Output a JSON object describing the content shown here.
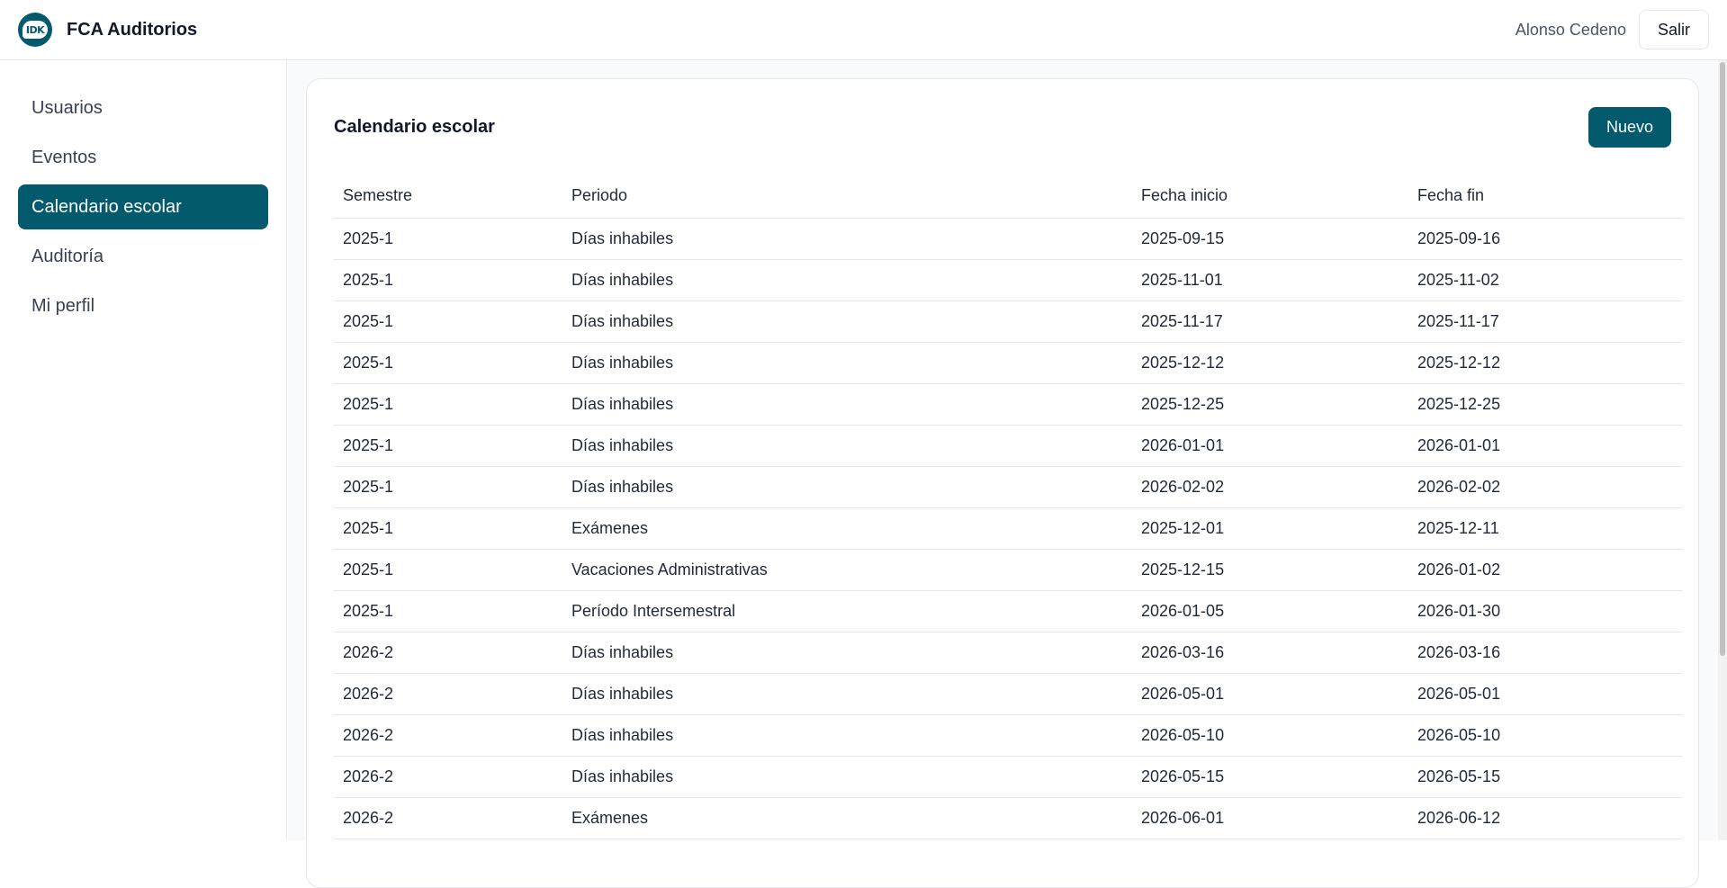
{
  "app": {
    "title": "FCA Auditorios",
    "logo_text": "IDK"
  },
  "header": {
    "user_name": "Alonso Cedeno",
    "logout_label": "Salir"
  },
  "sidebar": {
    "items": [
      {
        "label": "Usuarios"
      },
      {
        "label": "Eventos"
      },
      {
        "label": "Calendario escolar"
      },
      {
        "label": "Auditoría"
      },
      {
        "label": "Mi perfil"
      }
    ],
    "active_index": 2
  },
  "main": {
    "title": "Calendario escolar",
    "new_button_label": "Nuevo",
    "table": {
      "columns": [
        "Semestre",
        "Periodo",
        "Fecha inicio",
        "Fecha fin"
      ],
      "rows": [
        [
          "2025-1",
          "Días inhabiles",
          "2025-09-15",
          "2025-09-16"
        ],
        [
          "2025-1",
          "Días inhabiles",
          "2025-11-01",
          "2025-11-02"
        ],
        [
          "2025-1",
          "Días inhabiles",
          "2025-11-17",
          "2025-11-17"
        ],
        [
          "2025-1",
          "Días inhabiles",
          "2025-12-12",
          "2025-12-12"
        ],
        [
          "2025-1",
          "Días inhabiles",
          "2025-12-25",
          "2025-12-25"
        ],
        [
          "2025-1",
          "Días inhabiles",
          "2026-01-01",
          "2026-01-01"
        ],
        [
          "2025-1",
          "Días inhabiles",
          "2026-02-02",
          "2026-02-02"
        ],
        [
          "2025-1",
          "Exámenes",
          "2025-12-01",
          "2025-12-11"
        ],
        [
          "2025-1",
          "Vacaciones Administrativas",
          "2025-12-15",
          "2026-01-02"
        ],
        [
          "2025-1",
          "Período Intersemestral",
          "2026-01-05",
          "2026-01-30"
        ],
        [
          "2026-2",
          "Días inhabiles",
          "2026-03-16",
          "2026-03-16"
        ],
        [
          "2026-2",
          "Días inhabiles",
          "2026-05-01",
          "2026-05-01"
        ],
        [
          "2026-2",
          "Días inhabiles",
          "2026-05-10",
          "2026-05-10"
        ],
        [
          "2026-2",
          "Días inhabiles",
          "2026-05-15",
          "2026-05-15"
        ],
        [
          "2026-2",
          "Exámenes",
          "2026-06-01",
          "2026-06-12"
        ]
      ]
    }
  },
  "colors": {
    "primary": "#035a6c",
    "border": "#e5e7eb",
    "background": "#f9fafb"
  }
}
